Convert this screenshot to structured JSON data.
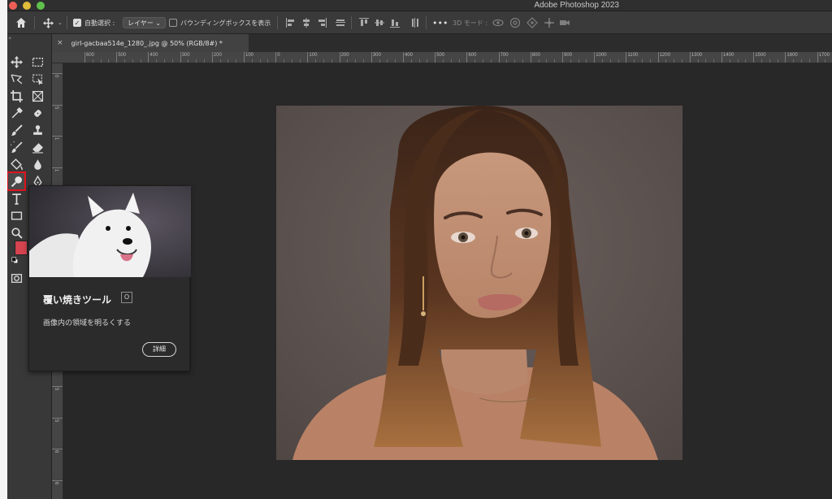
{
  "window": {
    "app_title": "Adobe Photoshop 2023"
  },
  "options_bar": {
    "auto_select_label": "自動選択 :",
    "layer_select_value": "レイヤー",
    "bounding_box_label": "バウンディングボックスを表示",
    "mode_3d_label": "3D モード :"
  },
  "document": {
    "tab_title": "girl-gacbaa514e_1280_.jpg @ 50% (RGB/8#) *",
    "close_symbol": "×"
  },
  "ruler": {
    "top_labels": [
      "600",
      "500",
      "400",
      "300",
      "200",
      "100",
      "0",
      "100",
      "200",
      "300",
      "400",
      "500",
      "600",
      "700",
      "800",
      "900",
      "1000",
      "1100",
      "1200",
      "1300",
      "1400",
      "1500",
      "1600",
      "1700"
    ],
    "left_labels": [
      "0",
      "5",
      "1",
      "1",
      "2",
      "2",
      "3",
      "3",
      "4",
      "4",
      "5",
      "5",
      "6",
      "6"
    ]
  },
  "tooltip": {
    "title": "覆い焼きツール",
    "shortcut": "O",
    "description": "画像内の領域を明るくする",
    "details_button": "詳細"
  },
  "colors": {
    "foreground": "#d5444f",
    "highlight": "#e0141e",
    "canvas_bg": "#282828"
  },
  "toolbar": {
    "tools": [
      "move-tool",
      "marquee-tool",
      "lasso-tool",
      "object-selection-tool",
      "crop-tool",
      "frame-tool",
      "eyedropper-tool",
      "healing-brush-tool",
      "brush-tool",
      "clone-stamp-tool",
      "history-brush-tool",
      "eraser-tool",
      "paint-bucket-tool",
      "blur-tool",
      "dodge-tool",
      "pen-tool",
      "type-tool",
      "rectangle-tool",
      "zoom-tool",
      "quick-mask-tool"
    ],
    "active_tool": "dodge-tool"
  }
}
